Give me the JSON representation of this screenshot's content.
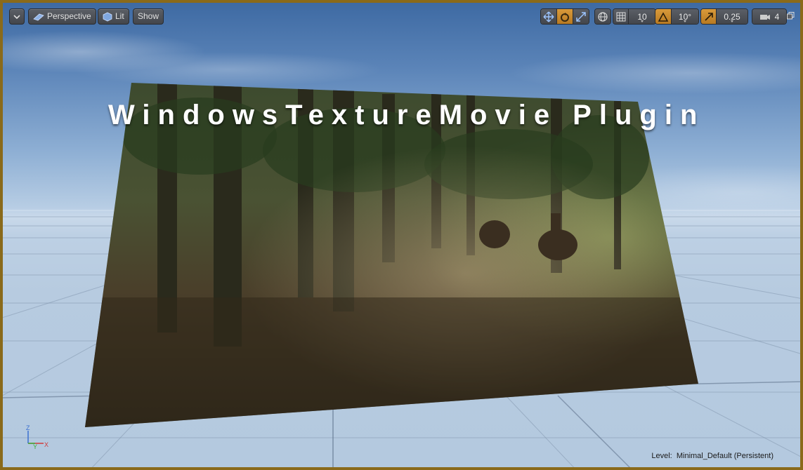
{
  "toolbar": {
    "menu_icon": "chevron-down-icon",
    "perspective_label": "Perspective",
    "lit_label": "Lit",
    "show_label": "Show",
    "grid_snap_value": "10",
    "rotation_snap_value": "10°",
    "scale_snap_value": "0.25",
    "camera_speed_value": "4"
  },
  "viewport": {
    "overlay_title": "WindowsTextureMovie Plugin",
    "level_label": "Level:",
    "level_name": "Minimal_Default (Persistent)",
    "axis_labels": {
      "z": "Z",
      "y": "Y",
      "x": "X"
    }
  },
  "colors": {
    "frame": "#8a6a1a",
    "active_toggle": "#d99a3a",
    "sky_top": "#3e6aa3",
    "ground": "#b7cbe0"
  }
}
